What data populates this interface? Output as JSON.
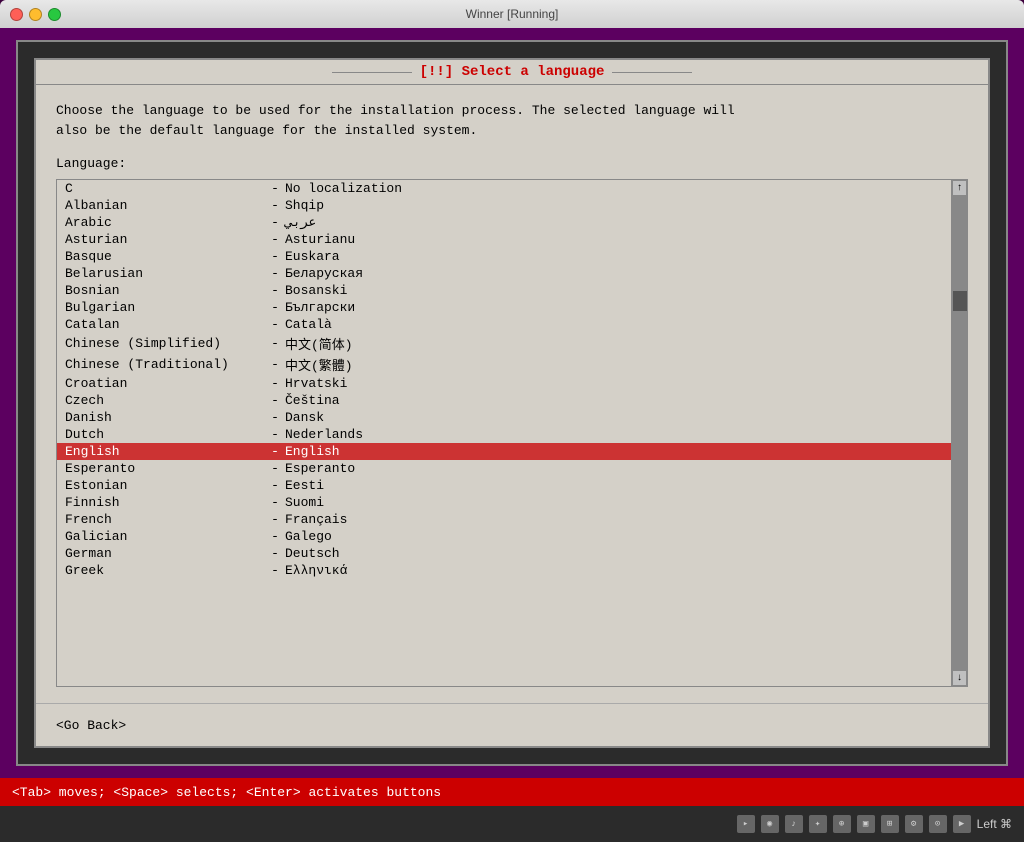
{
  "titlebar": {
    "title": "Winner [Running]"
  },
  "dialog": {
    "title": "[!!] Select a language",
    "description_line1": "Choose the language to be used for the installation process. The selected language will",
    "description_line2": "also be the default language for the installed system.",
    "language_label": "Language:",
    "languages": [
      {
        "name": "C",
        "sep": "-",
        "native": "No localization",
        "selected": false
      },
      {
        "name": "Albanian",
        "sep": "-",
        "native": "Shqip",
        "selected": false
      },
      {
        "name": "Arabic",
        "sep": "-",
        "native": "عربي",
        "selected": false
      },
      {
        "name": "Asturian",
        "sep": "-",
        "native": "Asturianu",
        "selected": false
      },
      {
        "name": "Basque",
        "sep": "-",
        "native": "Euskara",
        "selected": false
      },
      {
        "name": "Belarusian",
        "sep": "-",
        "native": "Беларуская",
        "selected": false
      },
      {
        "name": "Bosnian",
        "sep": "-",
        "native": "Bosanski",
        "selected": false
      },
      {
        "name": "Bulgarian",
        "sep": "-",
        "native": "Български",
        "selected": false
      },
      {
        "name": "Catalan",
        "sep": "-",
        "native": "Català",
        "selected": false
      },
      {
        "name": "Chinese (Simplified)",
        "sep": "-",
        "native": "中文(简体)",
        "selected": false
      },
      {
        "name": "Chinese (Traditional)",
        "sep": "-",
        "native": "中文(繁體)",
        "selected": false
      },
      {
        "name": "Croatian",
        "sep": "-",
        "native": "Hrvatski",
        "selected": false
      },
      {
        "name": "Czech",
        "sep": "-",
        "native": "Čeština",
        "selected": false
      },
      {
        "name": "Danish",
        "sep": "-",
        "native": "Dansk",
        "selected": false
      },
      {
        "name": "Dutch",
        "sep": "-",
        "native": "Nederlands",
        "selected": false
      },
      {
        "name": "English",
        "sep": "-",
        "native": "English",
        "selected": true
      },
      {
        "name": "Esperanto",
        "sep": "-",
        "native": "Esperanto",
        "selected": false
      },
      {
        "name": "Estonian",
        "sep": "-",
        "native": "Eesti",
        "selected": false
      },
      {
        "name": "Finnish",
        "sep": "-",
        "native": "Suomi",
        "selected": false
      },
      {
        "name": "French",
        "sep": "-",
        "native": "Français",
        "selected": false
      },
      {
        "name": "Galician",
        "sep": "-",
        "native": "Galego",
        "selected": false
      },
      {
        "name": "German",
        "sep": "-",
        "native": "Deutsch",
        "selected": false
      },
      {
        "name": "Greek",
        "sep": "-",
        "native": "Ελληνικά",
        "selected": false
      }
    ],
    "go_back_label": "<Go Back>",
    "scrollbar_up": "↑",
    "scrollbar_down": "↓"
  },
  "status_bar": {
    "text": "<Tab> moves; <Space> selects; <Enter> activates buttons"
  },
  "bottom_bar": {
    "text": "Left ⌘"
  }
}
